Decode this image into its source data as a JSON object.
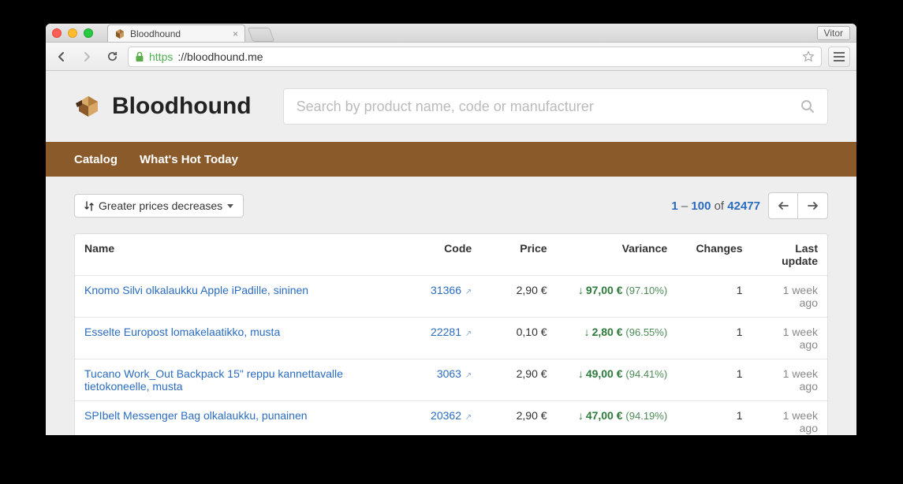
{
  "browser": {
    "tab_title": "Bloodhound",
    "profile": "Vitor",
    "url_scheme": "https",
    "url_host": "://bloodhound.me"
  },
  "header": {
    "brand": "Bloodhound",
    "search_placeholder": "Search by product name, code or manufacturer"
  },
  "nav": {
    "catalog": "Catalog",
    "hot": "What's Hot Today"
  },
  "toolbar": {
    "sort_label": "Greater prices decreases",
    "range_from": "1",
    "range_to": "100",
    "of_word": "of",
    "total": "42477"
  },
  "columns": {
    "name": "Name",
    "code": "Code",
    "price": "Price",
    "variance": "Variance",
    "changes": "Changes",
    "updated": "Last update"
  },
  "rows": [
    {
      "name": "Knomo Silvi olkalaukku Apple iPadille, sininen",
      "code": "31366",
      "price": "2,90 €",
      "variance_amount": "97,00 €",
      "variance_pct": "(97.10%)",
      "changes": "1",
      "updated": "1 week ago"
    },
    {
      "name": "Esselte Europost lomakelaatikko, musta",
      "code": "22281",
      "price": "0,10 €",
      "variance_amount": "2,80 €",
      "variance_pct": "(96.55%)",
      "changes": "1",
      "updated": "1 week ago"
    },
    {
      "name": "Tucano Work_Out Backpack 15\" reppu kannettavalle tietokoneelle, musta",
      "code": "3063",
      "price": "2,90 €",
      "variance_amount": "49,00 €",
      "variance_pct": "(94.41%)",
      "changes": "1",
      "updated": "1 week ago"
    },
    {
      "name": "SPIbelt Messenger Bag olkalaukku, punainen",
      "code": "20362",
      "price": "2,90 €",
      "variance_amount": "47,00 €",
      "variance_pct": "(94.19%)",
      "changes": "1",
      "updated": "1 week ago"
    }
  ]
}
